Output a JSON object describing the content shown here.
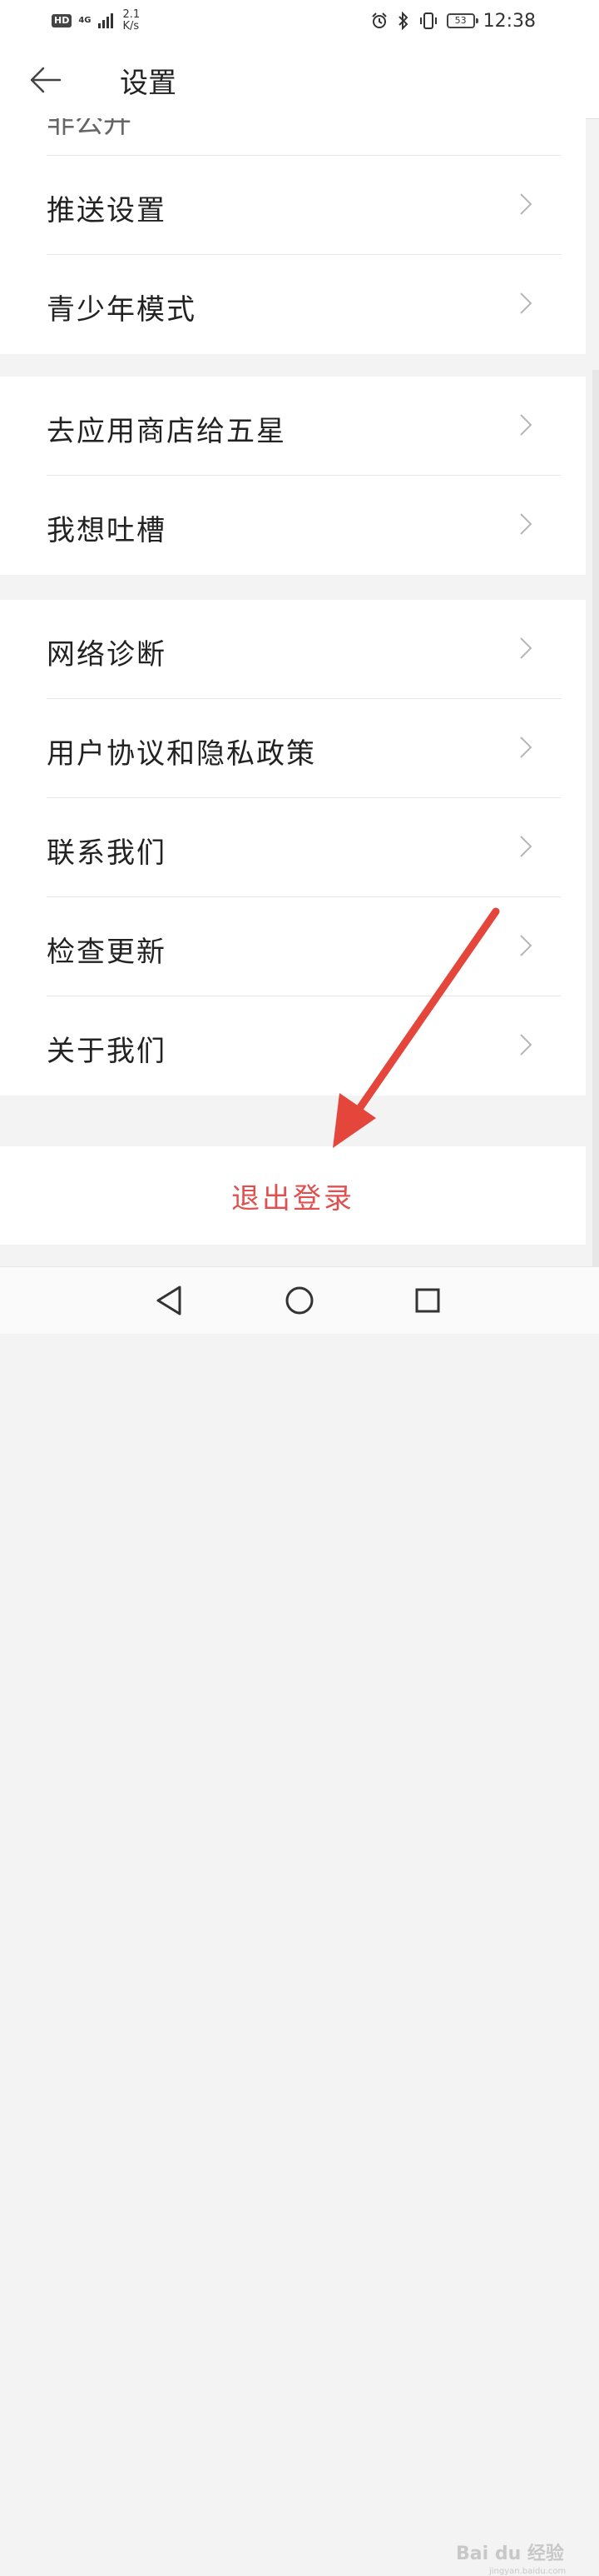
{
  "status_bar": {
    "hd": "HD",
    "net": "4G",
    "speed_value": "2.1",
    "speed_unit": "K/s",
    "battery": "53",
    "time": "12:38"
  },
  "app_bar": {
    "title": "设置"
  },
  "sections": [
    {
      "items": [
        "推送设置",
        "青少年模式"
      ]
    },
    {
      "items": [
        "去应用商店给五星",
        "我想吐槽"
      ]
    },
    {
      "items": [
        "网络诊断",
        "用户协议和隐私政策",
        "联系我们",
        "检查更新",
        "关于我们"
      ]
    }
  ],
  "partial_item": "非公开",
  "logout": {
    "label": "退出登录"
  },
  "icons": {
    "back": "back-arrow-icon",
    "chevron": "chevron-right-icon",
    "nav_back": "triangle-back-icon",
    "nav_home": "circle-home-icon",
    "nav_recents": "square-recents-icon"
  },
  "colors": {
    "logout_red": "#e05050",
    "arrow_red": "#e5463b",
    "chevron": "#b5b5b5"
  },
  "watermark": {
    "brand": "Bai du 经验",
    "site": "jingyan.baidu.com"
  }
}
